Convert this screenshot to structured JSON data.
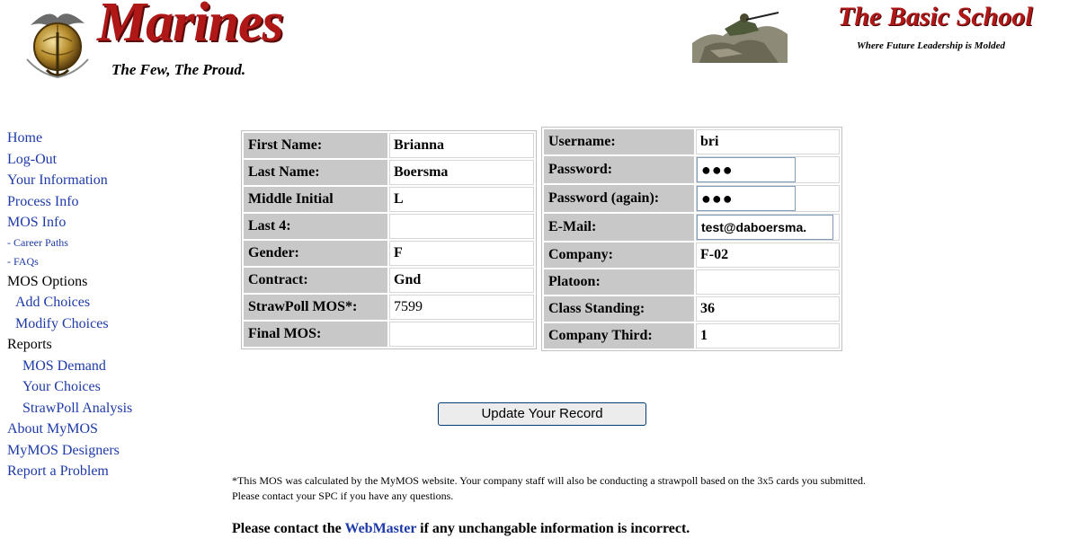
{
  "header": {
    "left_logo_text": "Marines",
    "left_logo_tagline": "The Few, The Proud.",
    "right_logo_text": "The Basic School",
    "right_logo_tagline": "Where Future Leadership is Molded"
  },
  "nav": {
    "home": "Home",
    "logout": "Log-Out",
    "your_information": "Your Information",
    "process_info": "Process Info",
    "mos_info": "MOS Info",
    "career_paths": "- Career Paths",
    "faqs": "- FAQs",
    "mos_options": "MOS Options",
    "add_choices": "Add Choices",
    "modify_choices": "Modify Choices",
    "reports": "Reports",
    "mos_demand": "MOS Demand",
    "your_choices": "Your Choices",
    "strawpoll_analysis": "StrawPoll Analysis",
    "about_mymos": "About MyMOS",
    "mymos_designers": "MyMOS Designers",
    "report_problem": "Report a Problem"
  },
  "personal": {
    "first_name_label": "First Name:",
    "first_name": "Brianna",
    "last_name_label": "Last Name:",
    "last_name": "Boersma",
    "middle_initial_label": "Middle Initial",
    "middle_initial": "L",
    "last4_label": "Last 4:",
    "last4": "",
    "gender_label": "Gender:",
    "gender": "F",
    "contract_label": "Contract:",
    "contract": "Gnd",
    "strawpoll_mos_label": "StrawPoll MOS*:",
    "strawpoll_mos": "7599",
    "final_mos_label": "Final MOS:",
    "final_mos": ""
  },
  "account": {
    "username_label": "Username:",
    "username": "bri",
    "password_label": "Password:",
    "password": "●●●",
    "password_again_label": "Password (again):",
    "password_again": "●●●",
    "email_label": "E-Mail:",
    "email": "test@daboersma.",
    "company_label": "Company:",
    "company": "F-02",
    "platoon_label": "Platoon:",
    "platoon": "",
    "class_standing_label": "Class Standing:",
    "class_standing": "36",
    "company_third_label": "Company Third:",
    "company_third": "1"
  },
  "update_button": "Update Your Record",
  "footnote": "*This MOS was calculated by the MyMOS website. Your company staff will also be conducting a strawpoll based on the 3x5 cards you submitted. Please contact your SPC if you have any questions.",
  "contact": {
    "before": "Please contact the ",
    "link": "WebMaster",
    "after": " if any unchangable information is incorrect."
  },
  "colors": {
    "link": "#1e3aa8",
    "brand_red": "#b01818",
    "label_bg": "#c8c8c8"
  }
}
